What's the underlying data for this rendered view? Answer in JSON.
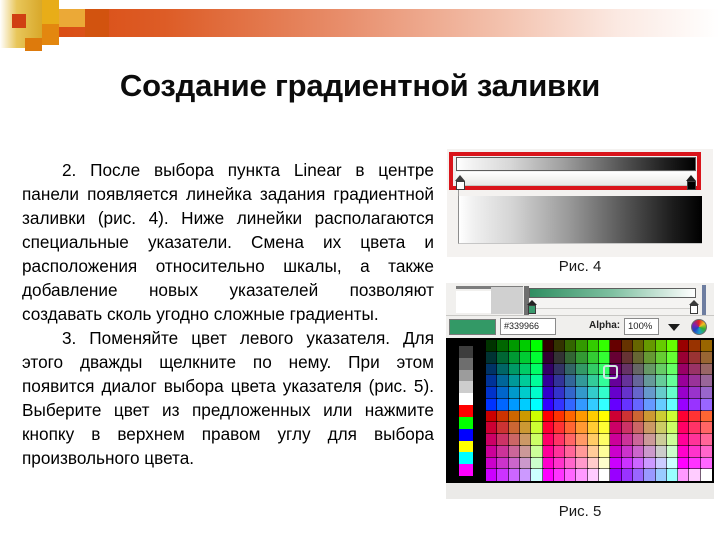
{
  "slide": {
    "title": "Создание градиентной заливки",
    "background": "#ffffff",
    "accent_orange": "#d94b11",
    "accent_gold": "#e8ad18"
  },
  "body": {
    "paragraphs": [
      "2. После выбора пункта Linear в центре панели появляется линейка задания градиентной заливки (рис. 4). Ниже линейки располагаются специальные указатели. Смена их цвета и расположения относительно шкалы, а также добавление новых указателей позволяют создавать сколь угодно сложные градиенты.",
      "3. Поменяйте цвет левого указателя. Для этого дважды щелкните по нему. При этом появится диалог выбора цвета указателя (рис. 5). Выберите цвет из предложенных или нажмите кнопку в верхнем правом углу для выбора произвольного цвета."
    ]
  },
  "figure4": {
    "caption": "Рис. 4",
    "highlight_color": "#d9141b",
    "gradient_from": "#ffffff",
    "gradient_to": "#000000",
    "left_stop_color": "#ffffff",
    "right_stop_color": "#000000"
  },
  "figure5": {
    "caption": "Рис. 5",
    "swatch_color": "#339966",
    "hex_value": "#339966",
    "alpha_label": "Alpha:",
    "alpha_value": "100%",
    "gradient_from": "#2f8e61",
    "gradient_to": "#ffffff",
    "left_stop_color": "#3a9a6d",
    "right_stop_color": "#ffffff",
    "color_wheel_icon": "color-wheel-icon",
    "dropdown_icon": "chevron-down-icon",
    "gray_column": [
      "#3d3d3d",
      "#6e6e6e",
      "#9c9c9c",
      "#cdcdcd",
      "#ffffff",
      "#ff0000",
      "#00ff00",
      "#0000ff",
      "#ffff00",
      "#00ffff",
      "#ff00ff"
    ],
    "grid_rows": 12,
    "grid_cols": 20,
    "grid_colors": [
      [
        "#003300",
        "#006600",
        "#009900",
        "#00cc00",
        "#00ff00",
        "#330000",
        "#333300",
        "#336600",
        "#339900",
        "#33cc00",
        "#33ff00",
        "#660000",
        "#663300",
        "#666600",
        "#669900",
        "#66cc00",
        "#66ff00",
        "#990000",
        "#993300",
        "#996600"
      ],
      [
        "#003333",
        "#006633",
        "#009933",
        "#00cc33",
        "#00ff33",
        "#330033",
        "#333333",
        "#336633",
        "#339933",
        "#33cc33",
        "#33ff33",
        "#660033",
        "#663333",
        "#666633",
        "#669933",
        "#66cc33",
        "#66ff33",
        "#990033",
        "#993333",
        "#996633"
      ],
      [
        "#003366",
        "#006666",
        "#009966",
        "#00cc66",
        "#00ff66",
        "#330066",
        "#333366",
        "#336666",
        "#339966",
        "#33cc66",
        "#33ff66",
        "#660066",
        "#663366",
        "#666666",
        "#669966",
        "#66cc66",
        "#66ff66",
        "#990066",
        "#993366",
        "#996666"
      ],
      [
        "#003399",
        "#006699",
        "#009999",
        "#00cc99",
        "#00ff99",
        "#330099",
        "#333399",
        "#336699",
        "#339999",
        "#33cc99",
        "#33ff99",
        "#660099",
        "#663399",
        "#666699",
        "#669999",
        "#66cc99",
        "#66ff99",
        "#990099",
        "#993399",
        "#996699"
      ],
      [
        "#0033cc",
        "#0066cc",
        "#0099cc",
        "#00cccc",
        "#00ffcc",
        "#3300cc",
        "#3333cc",
        "#3366cc",
        "#3399cc",
        "#33cccc",
        "#33ffcc",
        "#6600cc",
        "#6633cc",
        "#6666cc",
        "#6699cc",
        "#66cccc",
        "#66ffcc",
        "#9900cc",
        "#9933cc",
        "#9966cc"
      ],
      [
        "#0033ff",
        "#0066ff",
        "#0099ff",
        "#00ccff",
        "#00ffff",
        "#3300ff",
        "#3333ff",
        "#3366ff",
        "#3399ff",
        "#33ccff",
        "#33ffff",
        "#6600ff",
        "#6633ff",
        "#6666ff",
        "#6699ff",
        "#66ccff",
        "#66ffff",
        "#9900ff",
        "#9933ff",
        "#9966ff"
      ],
      [
        "#cc0000",
        "#cc3300",
        "#cc6600",
        "#cc9900",
        "#ccff00",
        "#ff0000",
        "#ff3300",
        "#ff6600",
        "#ff9900",
        "#ffcc00",
        "#ffff00",
        "#cc0033",
        "#cc3333",
        "#cc6633",
        "#cc9933",
        "#cccc33",
        "#ccff33",
        "#ff0033",
        "#ff3333",
        "#ff6633"
      ],
      [
        "#cc0033",
        "#cc3333",
        "#cc6633",
        "#cc9933",
        "#ccff33",
        "#ff0033",
        "#ff3333",
        "#ff6633",
        "#ff9933",
        "#ffcc33",
        "#ffff33",
        "#cc0066",
        "#cc3366",
        "#cc6666",
        "#cc9966",
        "#cccc66",
        "#ccff66",
        "#ff0066",
        "#ff3366",
        "#ff6666"
      ],
      [
        "#cc0066",
        "#cc3366",
        "#cc6666",
        "#cc9966",
        "#ccff66",
        "#ff0066",
        "#ff3366",
        "#ff6666",
        "#ff9966",
        "#ffcc66",
        "#ffff66",
        "#cc0099",
        "#cc3399",
        "#cc6699",
        "#cc9999",
        "#cccc99",
        "#ccff99",
        "#ff0099",
        "#ff3399",
        "#ff6699"
      ],
      [
        "#cc0099",
        "#cc3399",
        "#cc6699",
        "#cc9999",
        "#ccff99",
        "#ff0099",
        "#ff3399",
        "#ff6699",
        "#ff9999",
        "#ffcc99",
        "#ffff99",
        "#cc00cc",
        "#cc33cc",
        "#cc66cc",
        "#cc99cc",
        "#cccccc",
        "#ccffcc",
        "#ff00cc",
        "#ff33cc",
        "#ff66cc"
      ],
      [
        "#cc00cc",
        "#cc33cc",
        "#cc66cc",
        "#cc99cc",
        "#ccffcc",
        "#ff00cc",
        "#ff33cc",
        "#ff66cc",
        "#ff99cc",
        "#ffcccc",
        "#ffffcc",
        "#cc00ff",
        "#cc33ff",
        "#cc66ff",
        "#cc99ff",
        "#ccccff",
        "#ccffff",
        "#ff00ff",
        "#ff33ff",
        "#ff66ff"
      ],
      [
        "#cc00ff",
        "#cc33ff",
        "#cc66ff",
        "#cc99ff",
        "#ccffff",
        "#ff00ff",
        "#ff33ff",
        "#ff66ff",
        "#ff99ff",
        "#ffccff",
        "#ffffff",
        "#9900ff",
        "#9933ff",
        "#9966ff",
        "#9999ff",
        "#99ccff",
        "#99ffff",
        "#ff99ff",
        "#ffccff",
        "#ffffff"
      ]
    ]
  }
}
